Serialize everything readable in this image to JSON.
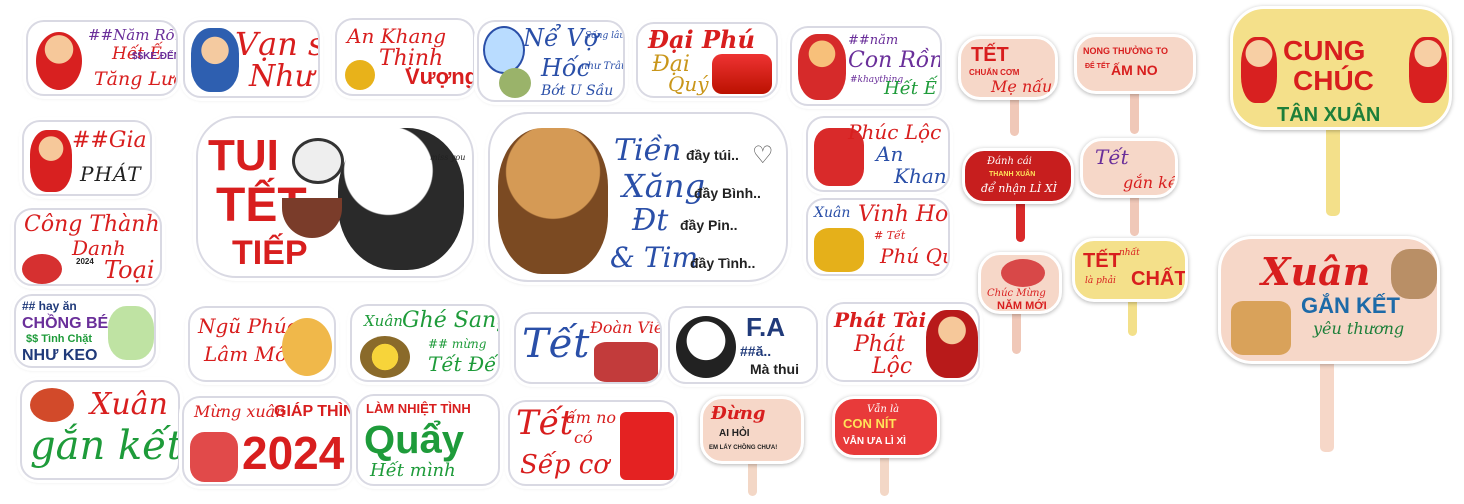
{
  "stickers": {
    "s1": {
      "l1": "##Năm Rồng",
      "l2": "Hết Ế",
      "l3": "$$KE ĐẾN",
      "l4": "Tăng Lương"
    },
    "s2": {
      "l1": "Vạn sự",
      "l2": "Như Ý"
    },
    "s3": {
      "l1": "An Khang",
      "l2": "Thịnh",
      "l3": "Vượng"
    },
    "s4": {
      "l1": "Nể Vợ",
      "l2": "Sống lâu",
      "l3": "Hốc",
      "l4": "như Trâu",
      "l5": "Bớt U Sầu"
    },
    "s5": {
      "l1": "Đại Phú",
      "l2": "Đại",
      "l3": "Quý"
    },
    "s6": {
      "l1": "##năm",
      "l2": "Con Rồng",
      "l3": "#khaything",
      "l4": "Hết Ế"
    },
    "s7": {
      "l1": "##Gia chủ",
      "l2": "PHÁT TÀI"
    },
    "s8": {
      "l1": "TUI",
      "l2": "TẾT",
      "l3": "TIẾP",
      "l4": "miss you"
    },
    "s9": {
      "l1": "Tiền",
      "l2": "đầy túi..",
      "l3": "Xăng",
      "l4": "đầy Bình..",
      "l5": "Đt",
      "l6": "đầy Pin..",
      "l7": "& Tim",
      "l8": "đầy Tình.."
    },
    "s10": {
      "l1": "Phúc Lộc",
      "l2": "An",
      "l3": "Khang"
    },
    "s11": {
      "l1": "Công Thành",
      "l2": "Danh",
      "l3": "Toại",
      "l4": "2024"
    },
    "s12": {
      "l1": "Xuân",
      "l2": "Vinh Hoa",
      "l3": "# Tết",
      "l4": "Phú Quý"
    },
    "s13": {
      "l1": "## hay ăn",
      "l2": "CHỒNG BÉO",
      "l3": "$$ Tình Chặt",
      "l4": "NHƯ KEO"
    },
    "s14": {
      "l1": "Ngũ Phúc",
      "l2": "Lâm Môn"
    },
    "s15": {
      "l1": "Xuân",
      "l2": "Ghé Sang",
      "l3": "## mừng",
      "l4": "Tết Đến"
    },
    "s16": {
      "l1": "Tết",
      "l2": "Đoàn Viên"
    },
    "s17": {
      "l1": "F.A",
      "l2": "##ă..",
      "l3": "Mà thui"
    },
    "s18": {
      "l1": "Phát Tài",
      "l2": "Phát",
      "l3": "Lộc"
    },
    "s19": {
      "l1": "Xuân",
      "l2": "gắn kết"
    },
    "s20": {
      "l1": "Mừng xuân",
      "l2": "GIÁP THÌN",
      "l3": "2024"
    },
    "s21": {
      "l1": "LÀM NHIỆT TÌNH",
      "l2": "Quẩy",
      "l3": "Hết mình"
    },
    "s22": {
      "l1": "Tết",
      "l2": "ấm no",
      "l3": "có",
      "l4": "Sếp cơ"
    }
  },
  "signs": {
    "p1": {
      "l1": "TẾT",
      "l2": "CHUẨN CƠM",
      "l3": "Mẹ nấu"
    },
    "p2": {
      "l1": "NONG THƯỞNG TO",
      "l2": "ĐỂ TẾT",
      "l3": "ẤM NO"
    },
    "p3": {
      "l1": "CUNG",
      "l2": "CHÚC",
      "l3": "TÂN XUÂN"
    },
    "p4": {
      "l1": "Đánh cái",
      "l2": "THANH XUÂN",
      "l3": "để nhận LÌ XÌ"
    },
    "p5": {
      "l1": "Tết",
      "l2": "gắn kết"
    },
    "p6": {
      "l1": "Chúc Mừng",
      "l2": "NĂM MỚI"
    },
    "p7": {
      "l1": "TẾT",
      "l2": "nhất",
      "l3": "là phải",
      "l4": "CHẤT"
    },
    "p8": {
      "l1": "Xuân",
      "l2": "GẮN KẾT",
      "l3": "yêu thương"
    },
    "p9": {
      "l1": "Đừng",
      "l2": "AI HỎI",
      "l3": "EM LẤY CHỒNG CHƯA!"
    },
    "p10": {
      "l1": "Vẫn là",
      "l2": "CON NÍT",
      "l3": "VẪN ƯA LÌ XÌ"
    }
  },
  "colors": {
    "red": "#d81e1e",
    "blue": "#2a4fa8",
    "green": "#1e9b3a",
    "gold": "#c9961a",
    "signPink": "#f6d7c8",
    "signYellow": "#f4e08a"
  }
}
